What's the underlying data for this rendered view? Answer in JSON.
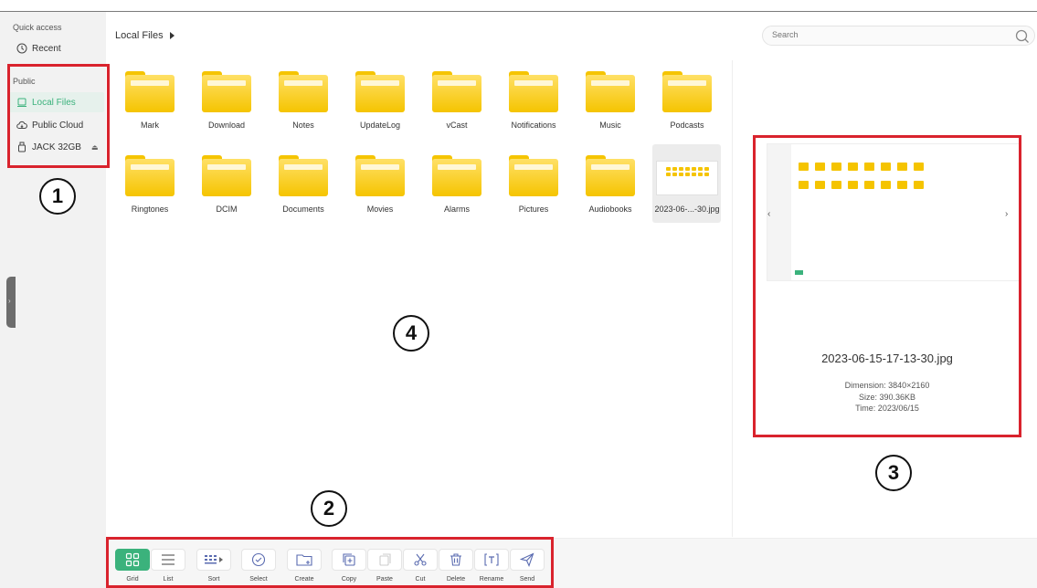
{
  "sidebar": {
    "quick_access": "Quick access",
    "recent": "Recent",
    "public": "Public",
    "local_files": "Local Files",
    "public_cloud": "Public Cloud",
    "usb": "JACK 32GB",
    "eject": "⏏"
  },
  "header": {
    "breadcrumb": "Local Files",
    "search_placeholder": "Search"
  },
  "files": [
    {
      "name": "Mark",
      "type": "folder"
    },
    {
      "name": "Download",
      "type": "folder"
    },
    {
      "name": "Notes",
      "type": "folder"
    },
    {
      "name": "UpdateLog",
      "type": "folder"
    },
    {
      "name": "vCast",
      "type": "folder"
    },
    {
      "name": "Notifications",
      "type": "folder"
    },
    {
      "name": "Music",
      "type": "folder"
    },
    {
      "name": "Podcasts",
      "type": "folder"
    },
    {
      "name": "Ringtones",
      "type": "folder"
    },
    {
      "name": "DCIM",
      "type": "folder"
    },
    {
      "name": "Documents",
      "type": "folder"
    },
    {
      "name": "Movies",
      "type": "folder"
    },
    {
      "name": "Alarms",
      "type": "folder"
    },
    {
      "name": "Pictures",
      "type": "folder"
    },
    {
      "name": "Audiobooks",
      "type": "folder"
    },
    {
      "name": "2023-06-...-30.jpg",
      "type": "image"
    }
  ],
  "preview": {
    "filename": "2023-06-15-17-13-30.jpg",
    "dimension": "Dimension: 3840×2160",
    "size": "Size: 390.36KB",
    "time": "Time: 2023/06/15"
  },
  "toolbar": {
    "grid": "Grid",
    "list": "List",
    "sort": "Sort",
    "select": "Select",
    "create": "Create",
    "copy": "Copy",
    "paste": "Paste",
    "cut": "Cut",
    "delete": "Delete",
    "rename": "Rename",
    "send": "Send"
  },
  "callouts": {
    "c1": "1",
    "c2": "2",
    "c3": "3",
    "c4": "4"
  },
  "colors": {
    "accent": "#3bb27c",
    "folder": "#f5c400",
    "annotation": "#d9232d"
  }
}
